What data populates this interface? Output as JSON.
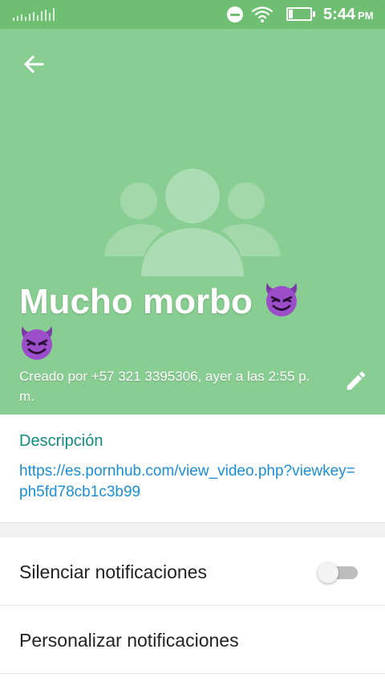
{
  "status_bar": {
    "time": "5:44",
    "ampm": "PM"
  },
  "icons": {
    "back": "arrow-left-icon",
    "edit": "pencil-icon",
    "group_placeholder": "group-avatar-icon",
    "emoji": "smiling-devil-emoji"
  },
  "colors": {
    "header_bg": "#88cd92",
    "statusbar_bg": "#6fbf73",
    "accent_label": "#128c7e",
    "link": "#1a8ed6"
  },
  "group": {
    "name": "Mucho morbo",
    "created": "Creado por +57 321 3395306, ayer a las 2:55 p. m."
  },
  "description": {
    "label": "Descripción",
    "text": "https://es.pornhub.com/view_video.php?viewkey=ph5fd78cb1c3b99"
  },
  "settings": {
    "mute_label": "Silenciar notificaciones",
    "mute_enabled": false,
    "custom_label": "Personalizar notificaciones"
  }
}
